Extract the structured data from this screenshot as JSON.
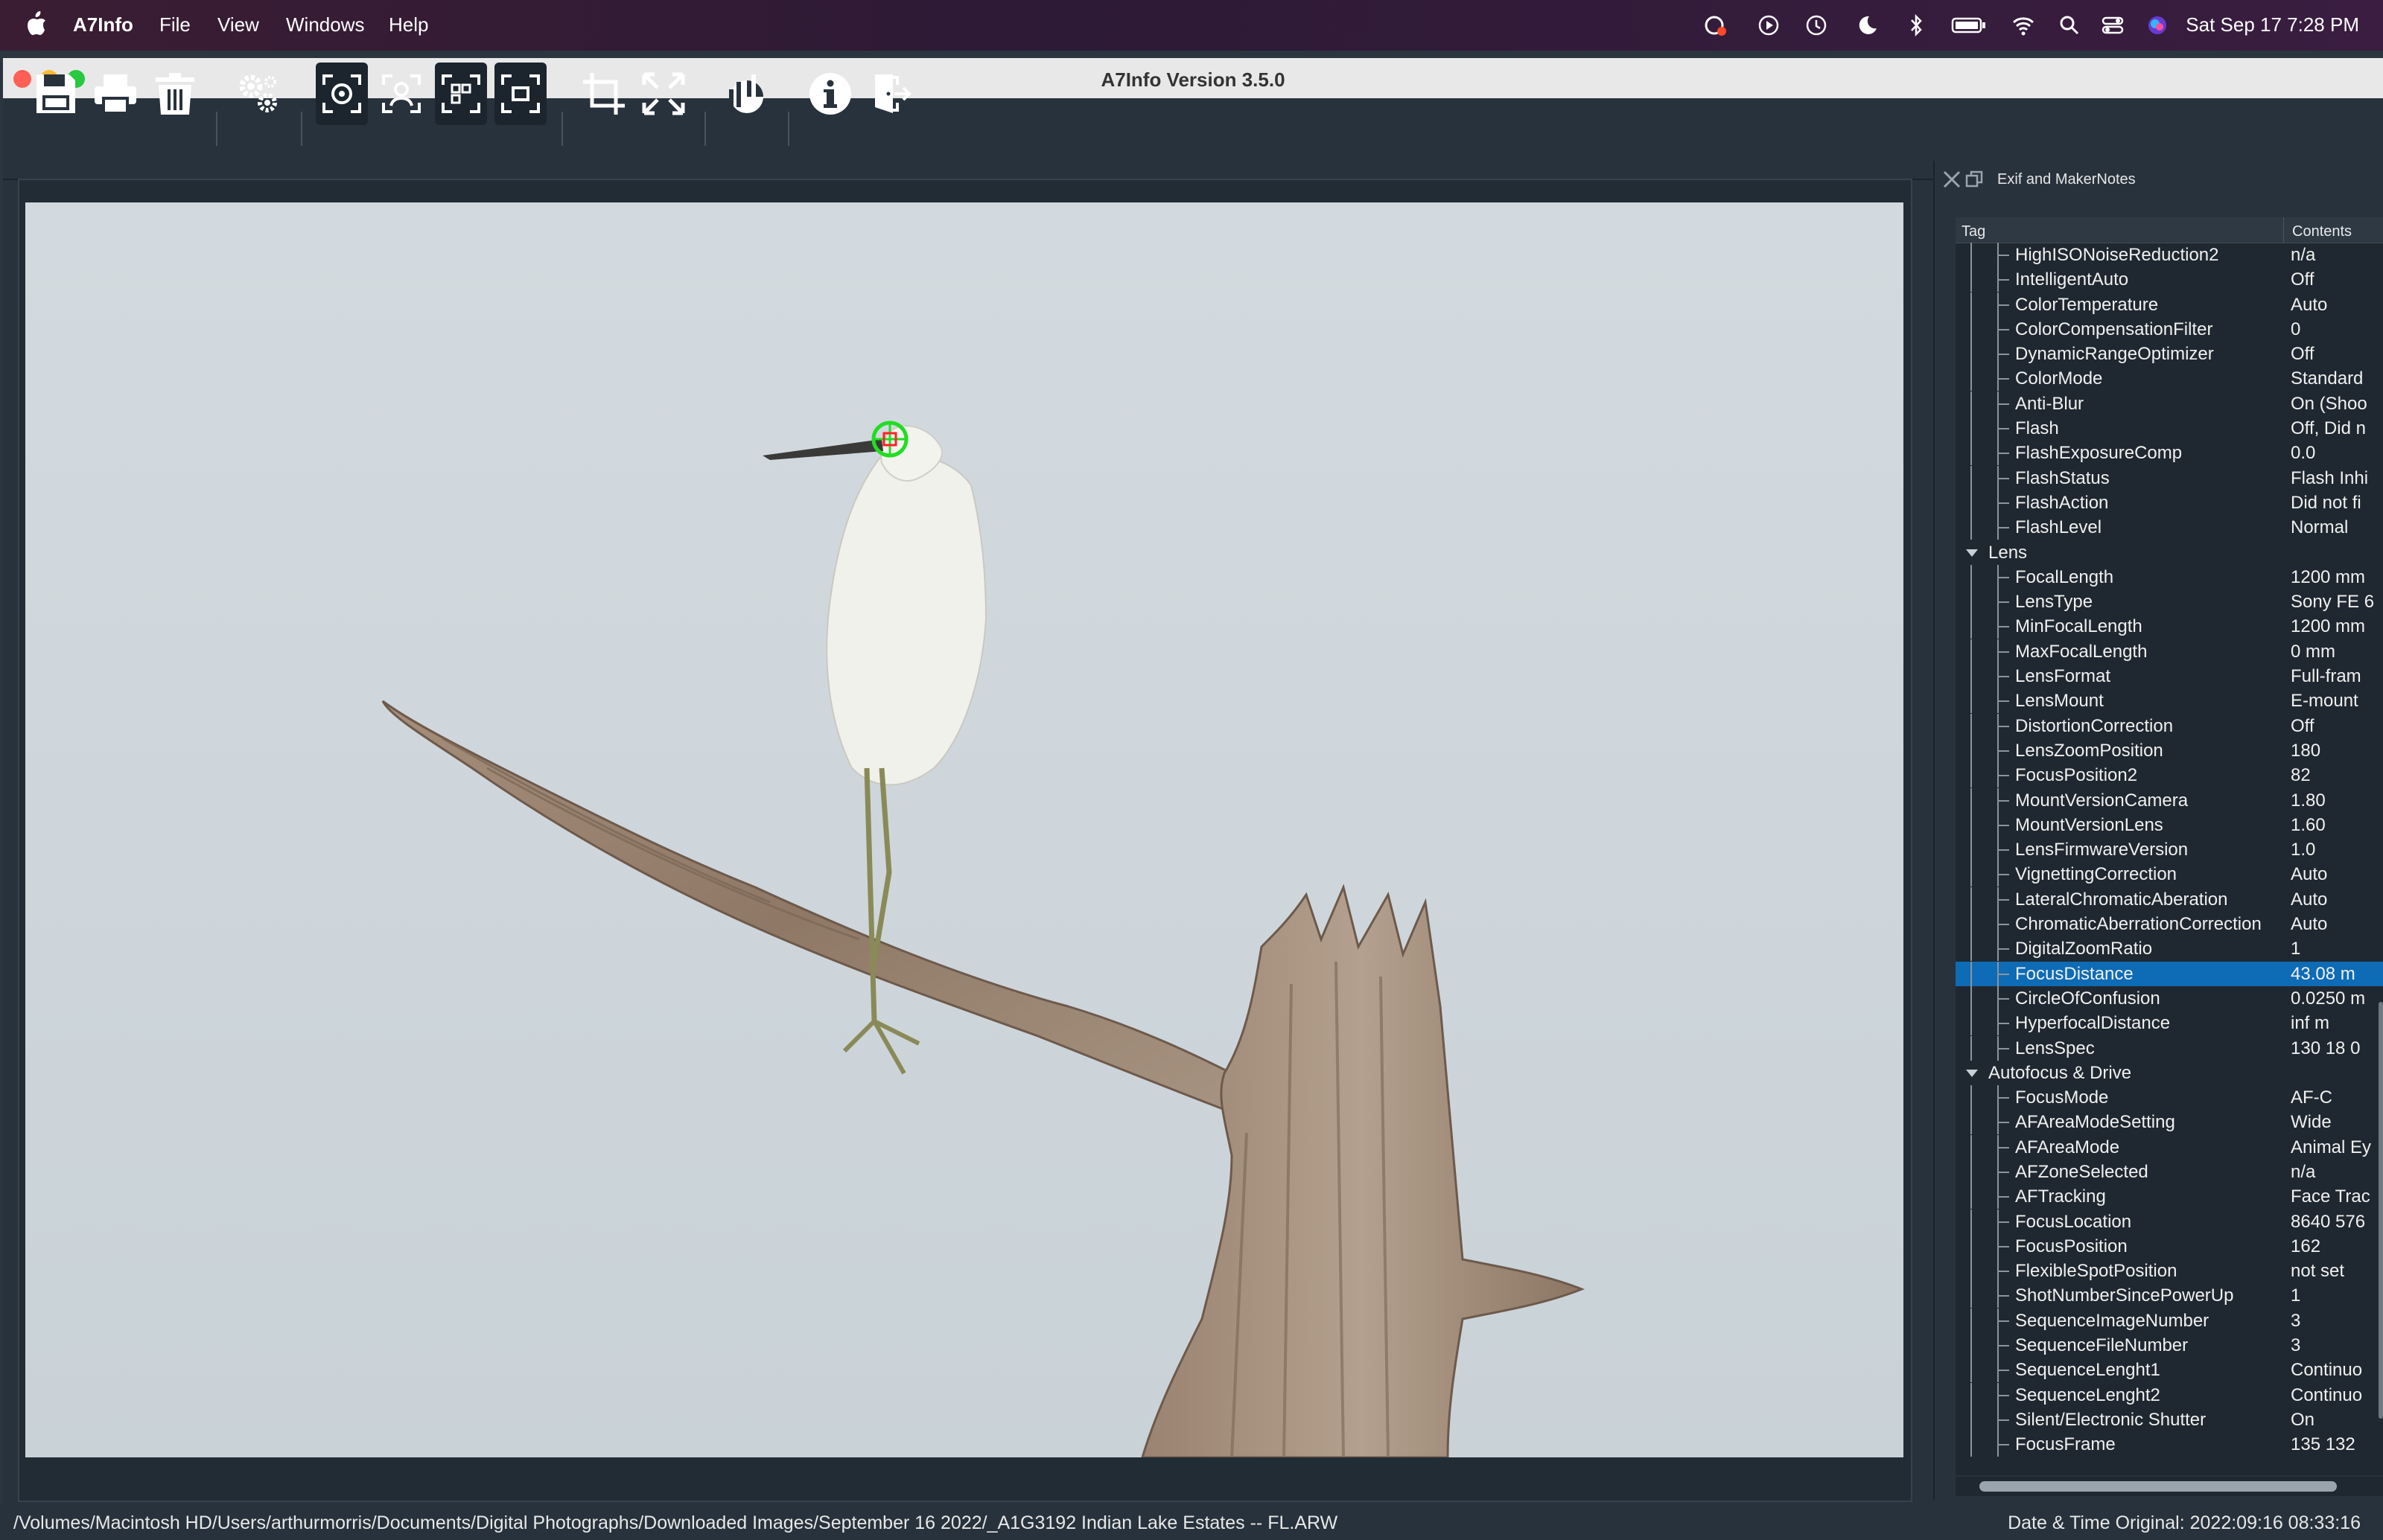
{
  "menubar": {
    "app_name": "A7Info",
    "items": [
      "File",
      "View",
      "Windows",
      "Help"
    ],
    "clock": "Sat Sep 17  7:28 PM"
  },
  "window": {
    "title": "A7Info Version 3.5.0"
  },
  "toolbar": {
    "icons": [
      "save-icon",
      "print-icon",
      "trash-icon",
      "settings-icon",
      "focus-point-icon",
      "face-detect-icon",
      "focus-area-icon",
      "focus-frame-icon",
      "crop-icon",
      "fullscreen-icon",
      "histogram-icon",
      "info-icon",
      "exit-icon"
    ]
  },
  "exif": {
    "panel_title": "Exif and MakerNotes",
    "col_tag": "Tag",
    "col_contents": "Contents",
    "rows": [
      {
        "tag": "HighISONoiseReduction2",
        "val": "n/a",
        "level": 2
      },
      {
        "tag": "IntelligentAuto",
        "val": "Off",
        "level": 2
      },
      {
        "tag": "ColorTemperature",
        "val": "Auto",
        "level": 2
      },
      {
        "tag": "ColorCompensationFilter",
        "val": "0",
        "level": 2
      },
      {
        "tag": "DynamicRangeOptimizer",
        "val": "Off",
        "level": 2
      },
      {
        "tag": "ColorMode",
        "val": "Standard",
        "level": 2
      },
      {
        "tag": "Anti-Blur",
        "val": "On (Shoo",
        "level": 2
      },
      {
        "tag": "Flash",
        "val": "Off, Did n",
        "level": 2
      },
      {
        "tag": "FlashExposureComp",
        "val": "0.0",
        "level": 2
      },
      {
        "tag": "FlashStatus",
        "val": "Flash Inhi",
        "level": 2
      },
      {
        "tag": "FlashAction",
        "val": "Did not fi",
        "level": 2
      },
      {
        "tag": "FlashLevel",
        "val": "Normal",
        "level": 2
      },
      {
        "tag": "Lens",
        "val": "",
        "level": 1
      },
      {
        "tag": "FocalLength",
        "val": "1200 mm",
        "level": 2
      },
      {
        "tag": "LensType",
        "val": "Sony FE 6",
        "level": 2
      },
      {
        "tag": "MinFocalLength",
        "val": "1200 mm",
        "level": 2
      },
      {
        "tag": "MaxFocalLength",
        "val": "0 mm",
        "level": 2
      },
      {
        "tag": "LensFormat",
        "val": "Full-fram",
        "level": 2
      },
      {
        "tag": "LensMount",
        "val": "E-mount",
        "level": 2
      },
      {
        "tag": "DistortionCorrection",
        "val": "Off",
        "level": 2
      },
      {
        "tag": "LensZoomPosition",
        "val": "180",
        "level": 2
      },
      {
        "tag": "FocusPosition2",
        "val": "82",
        "level": 2
      },
      {
        "tag": "MountVersionCamera",
        "val": "1.80",
        "level": 2
      },
      {
        "tag": "MountVersionLens",
        "val": "1.60",
        "level": 2
      },
      {
        "tag": "LensFirmwareVersion",
        "val": "1.0",
        "level": 2
      },
      {
        "tag": "VignettingCorrection",
        "val": "Auto",
        "level": 2
      },
      {
        "tag": "LateralChromaticAberation",
        "val": "Auto",
        "level": 2
      },
      {
        "tag": "ChromaticAberrationCorrection",
        "val": "Auto",
        "level": 2
      },
      {
        "tag": "DigitalZoomRatio",
        "val": "1",
        "level": 2
      },
      {
        "tag": "FocusDistance",
        "val": "43.08 m",
        "level": 2,
        "selected": true
      },
      {
        "tag": "CircleOfConfusion",
        "val": "0.0250 m",
        "level": 2
      },
      {
        "tag": "HyperfocalDistance",
        "val": "inf m",
        "level": 2
      },
      {
        "tag": "LensSpec",
        "val": "130 18 0",
        "level": 2
      },
      {
        "tag": "Autofocus & Drive",
        "val": "",
        "level": 1
      },
      {
        "tag": "FocusMode",
        "val": "AF-C",
        "level": 2
      },
      {
        "tag": "AFAreaModeSetting",
        "val": "Wide",
        "level": 2
      },
      {
        "tag": "AFAreaMode",
        "val": "Animal Ey",
        "level": 2
      },
      {
        "tag": "AFZoneSelected",
        "val": "n/a",
        "level": 2
      },
      {
        "tag": "AFTracking",
        "val": "Face Trac",
        "level": 2
      },
      {
        "tag": "FocusLocation",
        "val": "8640 576",
        "level": 2
      },
      {
        "tag": "FocusPosition",
        "val": "162",
        "level": 2
      },
      {
        "tag": "FlexibleSpotPosition",
        "val": "not set",
        "level": 2
      },
      {
        "tag": "ShotNumberSincePowerUp",
        "val": "1",
        "level": 2
      },
      {
        "tag": "SequenceImageNumber",
        "val": "3",
        "level": 2
      },
      {
        "tag": "SequenceFileNumber",
        "val": "3",
        "level": 2
      },
      {
        "tag": "SequenceLenght1",
        "val": "Continuo",
        "level": 2
      },
      {
        "tag": "SequenceLenght2",
        "val": "Continuo",
        "level": 2
      },
      {
        "tag": "Silent/Electronic Shutter",
        "val": "On",
        "level": 2
      },
      {
        "tag": "FocusFrame",
        "val": "135 132",
        "level": 2
      }
    ]
  },
  "status": {
    "path": "/Volumes/Macintosh HD/Users/arthurmorris/Documents/Digital Photographs/Downloaded Images/September 16 2022/_A1G3192  Indian Lake Estates -- FL.ARW",
    "datetime": "Date & Time Original: 2022:09:16 08:33:16"
  },
  "colors": {
    "accent": "#0e6bb5",
    "focus_marker": "#22dd22",
    "focus_center": "#ff2222"
  }
}
